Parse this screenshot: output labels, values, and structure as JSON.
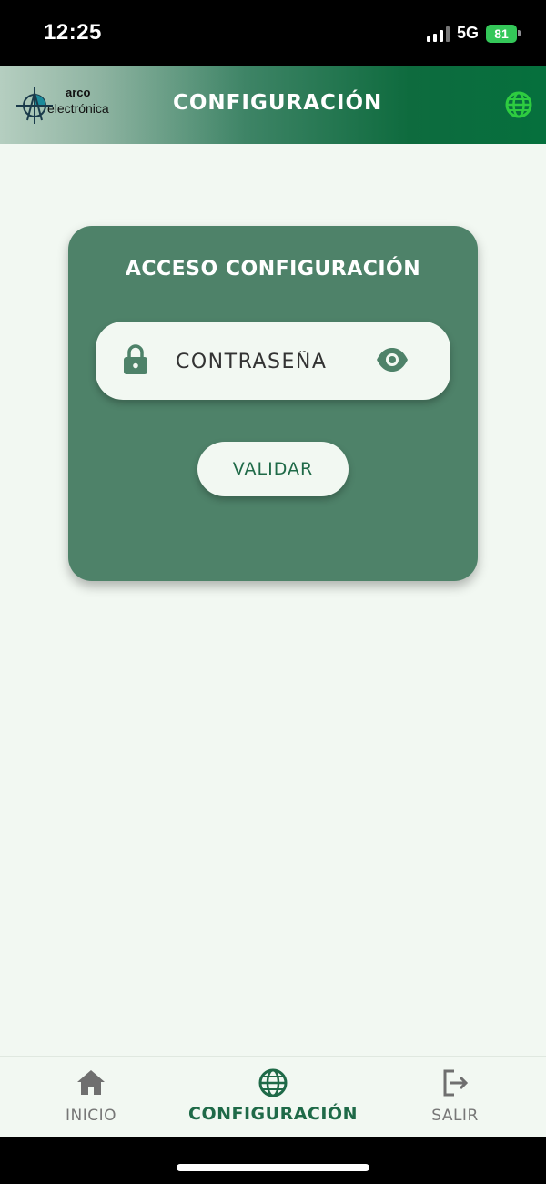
{
  "status_bar": {
    "time": "12:25",
    "network": "5G",
    "battery": "81"
  },
  "header": {
    "logo": {
      "text_top": "arco",
      "text_bottom": "electrónica"
    },
    "title": "CONFIGURACIÓN",
    "language_icon": "globe-icon"
  },
  "card": {
    "title": "ACCESO CONFIGURACIÓN",
    "password": {
      "placeholder": "CONTRASEÑA",
      "value": "",
      "leading_icon": "lock-icon",
      "trailing_icon": "eye-icon"
    },
    "validate_label": "VALIDAR"
  },
  "bottom_nav": {
    "items": [
      {
        "label": "INICIO",
        "icon": "home-icon",
        "active": false
      },
      {
        "label": "CONFIGURACIÓN",
        "icon": "globe-icon",
        "active": true
      },
      {
        "label": "SALIR",
        "icon": "logout-icon",
        "active": false
      }
    ]
  },
  "colors": {
    "primary": "#1f6a48",
    "card": "#4e8269",
    "background": "#f2f8f2",
    "header_icon": "#2ecc40",
    "battery": "#34c759"
  }
}
